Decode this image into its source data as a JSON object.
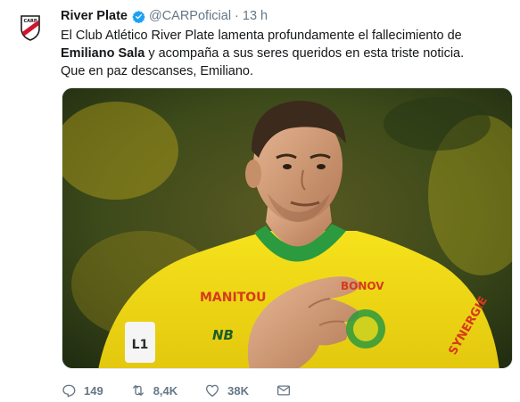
{
  "tweet": {
    "author_name": "River Plate",
    "handle": "@CARPoficial",
    "separator": "·",
    "time": "13 h",
    "text_part1": "El Club Atlético River Plate lamenta profundamente el fallecimiento de ",
    "text_bold1": "Emiliano Sala",
    "text_part2": " y acompaña a sus seres queridos en esta triste noticia.",
    "text_line2": "Que en paz descanses, Emiliano.",
    "media": {
      "sponsor": "MANITOU",
      "kit_brand": "NB",
      "sleeve_text": "SYNERGIE",
      "partner_text": "BONOV",
      "accent_color": "#f2dc18",
      "collar_color": "#2c9a3e"
    }
  },
  "actions": {
    "reply_count": "149",
    "retweet_count": "8,4K",
    "like_count": "38K"
  },
  "icons": {
    "avatar": "river-plate-crest-icon",
    "verified": "verified-badge-icon",
    "reply": "reply-icon",
    "retweet": "retweet-icon",
    "like": "heart-icon",
    "dm": "envelope-icon"
  },
  "colors": {
    "text": "#14171a",
    "muted": "#657786",
    "verified": "#1da1f2",
    "river_red": "#d0142c"
  }
}
